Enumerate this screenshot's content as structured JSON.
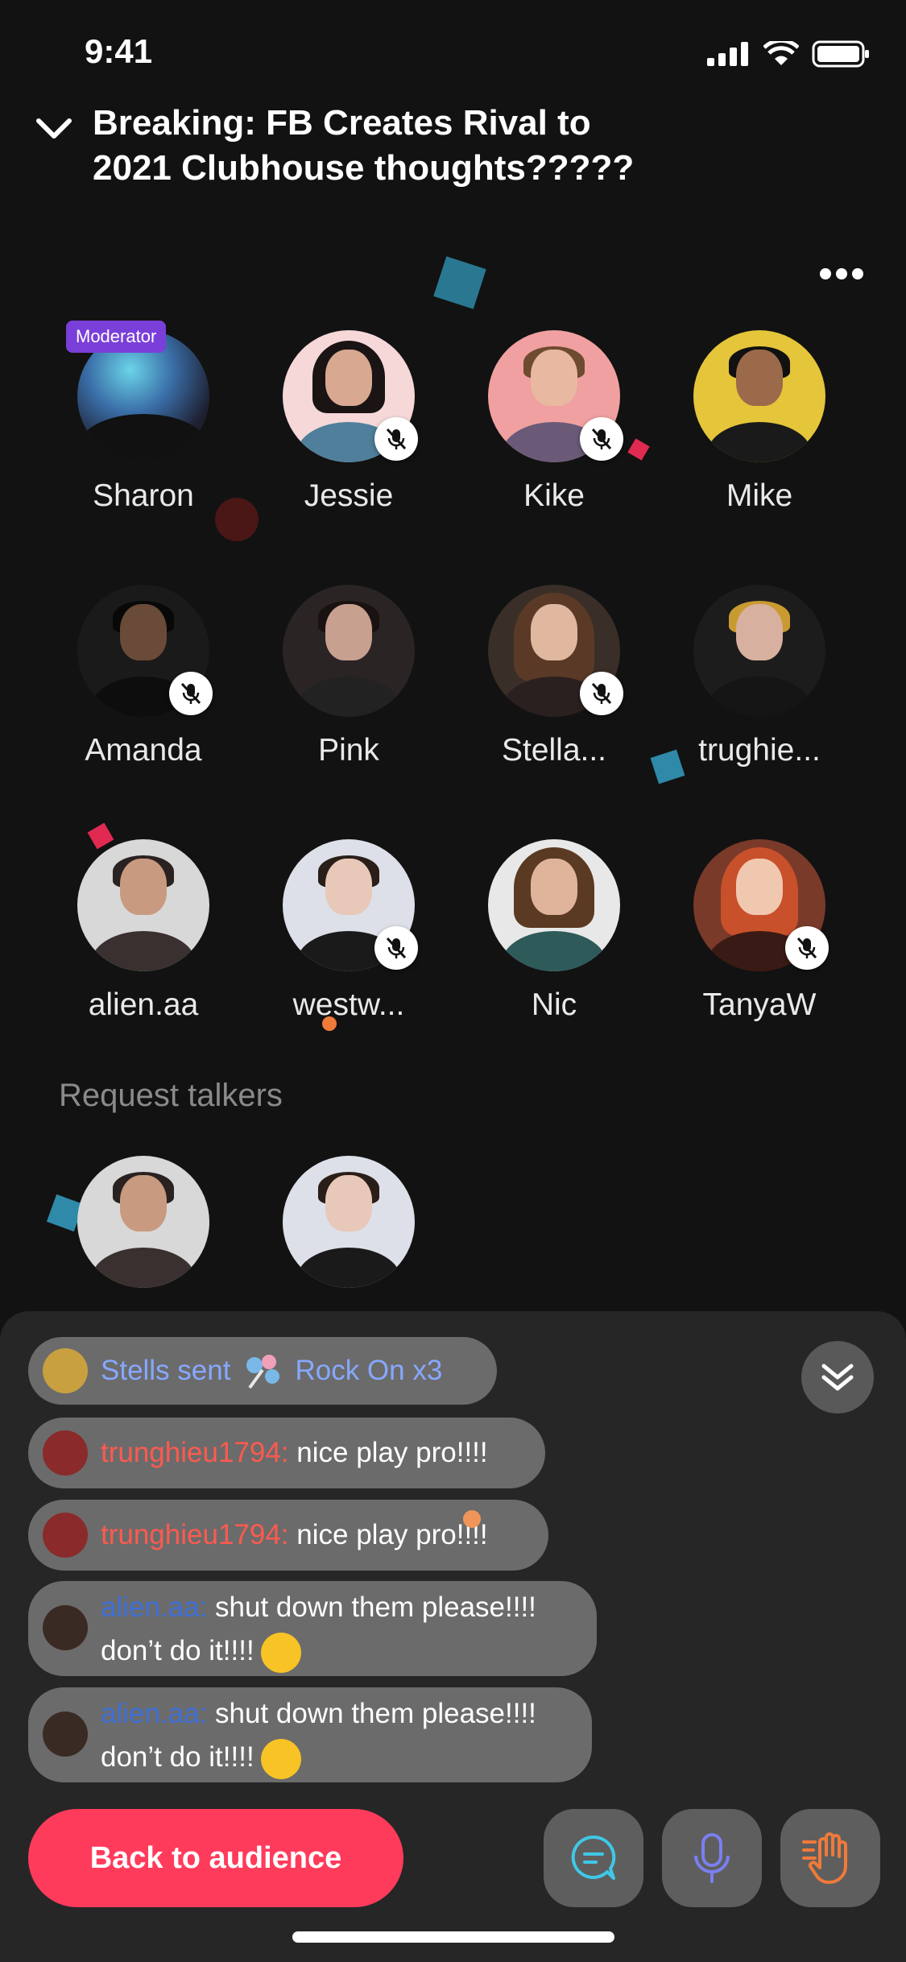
{
  "status_bar": {
    "time": "9:41"
  },
  "header": {
    "title_line1": "Breaking: FB Creates Rival to",
    "title_line2": "2021 Clubhouse thoughts?????"
  },
  "speakers": [
    {
      "name": "Sharon",
      "badge": "Moderator",
      "muted": false
    },
    {
      "name": "Jessie",
      "muted": true
    },
    {
      "name": "Kike",
      "muted": true
    },
    {
      "name": "Mike",
      "muted": false
    },
    {
      "name": "Amanda",
      "muted": true
    },
    {
      "name": "Pink",
      "muted": false
    },
    {
      "name": "Stella...",
      "muted": true
    },
    {
      "name": "trughie...",
      "muted": false
    },
    {
      "name": "alien.aa",
      "muted": false
    },
    {
      "name": "westw...",
      "muted": true
    },
    {
      "name": "Nic",
      "muted": false
    },
    {
      "name": "TanyaW",
      "muted": true
    }
  ],
  "request_section": {
    "title": "Request talkers"
  },
  "chat": {
    "gift": {
      "sender": "Stells sent",
      "gift": "Rock On x3"
    },
    "messages": [
      {
        "user": "trunghieu1794:",
        "text": " nice play pro!!!!"
      },
      {
        "user": "trunghieu1794:",
        "text": " nice play pro!!!!"
      },
      {
        "user": "alien.aa:",
        "text": " shut down them please!!!!",
        "text2": "don’t do it!!!!"
      },
      {
        "user": "alien.aa:",
        "text": " shut down them please!!!!",
        "text2": "don’t do it!!!!"
      }
    ]
  },
  "bottom_bar": {
    "back_label": "Back to audience"
  },
  "colors": {
    "accent": "#ff3b5c",
    "background": "#121212",
    "panel": "#262626",
    "moderator": "#7a3fd8"
  },
  "icons": [
    "chevron-down-icon",
    "more-icon",
    "mic-off-icon",
    "chevrons-down-icon",
    "chat-icon",
    "mic-icon",
    "raise-hand-icon"
  ]
}
